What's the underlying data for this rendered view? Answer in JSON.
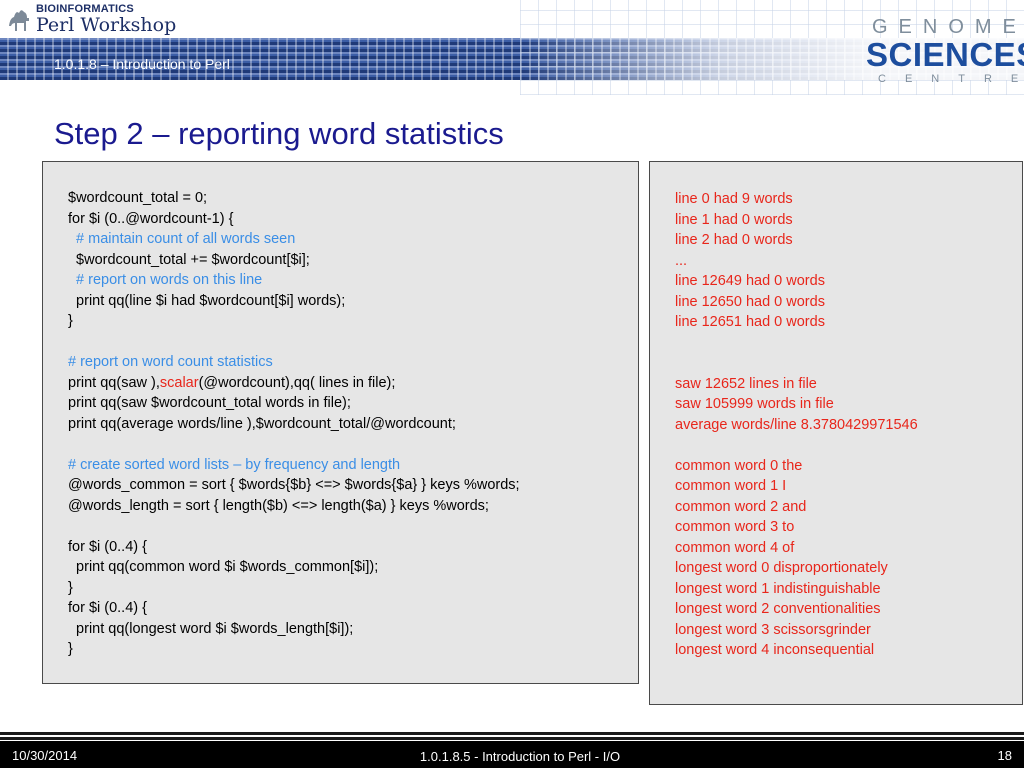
{
  "header": {
    "logo_top": "BIOINFORMATICS",
    "logo_main": "Perl Workshop",
    "subtitle": "1.0.1.8 – Introduction to Perl",
    "gsc_line1": "GENOME",
    "gsc_line2": "SCIENCES",
    "gsc_line3": "CENTRE"
  },
  "slide": {
    "title": "Step 2 – reporting word statistics"
  },
  "code": {
    "lines": [
      {
        "t": "$wordcount_total = 0;",
        "k": "code"
      },
      {
        "t": "for $i (0..@wordcount-1) {",
        "k": "code"
      },
      {
        "t": "  # maintain count of all words seen",
        "k": "comment"
      },
      {
        "t": "  $wordcount_total += $wordcount[$i];",
        "k": "code"
      },
      {
        "t": "  # report on words on this line",
        "k": "comment"
      },
      {
        "t": "  print qq(line $i had $wordcount[$i] words);",
        "k": "code"
      },
      {
        "t": "}",
        "k": "code"
      },
      {
        "t": "",
        "k": "code"
      },
      {
        "t": "# report on word count statistics",
        "k": "comment"
      },
      {
        "t": "print qq(saw ),",
        "kw": "scalar",
        "post": "(@wordcount),qq( lines in file);",
        "k": "code"
      },
      {
        "t": "print qq(saw $wordcount_total words in file);",
        "k": "code"
      },
      {
        "t": "print qq(average words/line ),$wordcount_total/@wordcount;",
        "k": "code"
      },
      {
        "t": "",
        "k": "code"
      },
      {
        "t": "# create sorted word lists – by frequency and length",
        "k": "comment"
      },
      {
        "t": "@words_common = sort { $words{$b} <=> $words{$a} } keys %words;",
        "k": "code"
      },
      {
        "t": "@words_length = sort { length($b) <=> length($a) } keys %words;",
        "k": "code"
      },
      {
        "t": "",
        "k": "code"
      },
      {
        "t": "for $i (0..4) {",
        "k": "code"
      },
      {
        "t": "  print qq(common word $i $words_common[$i]);",
        "k": "code"
      },
      {
        "t": "}",
        "k": "code"
      },
      {
        "t": "for $i (0..4) {",
        "k": "code"
      },
      {
        "t": "  print qq(longest word $i $words_length[$i]);",
        "k": "code"
      },
      {
        "t": "}",
        "k": "code"
      }
    ]
  },
  "output": {
    "lines": [
      "line 0 had 9 words",
      "line 1 had 0 words",
      "line 2 had 0 words",
      "...",
      "line 12649 had 0 words",
      "line 12650 had 0 words",
      "line 12651 had 0 words",
      "",
      "",
      "saw 12652 lines in file",
      "saw 105999 words in file",
      "average words/line 8.3780429971546",
      "",
      "common word 0 the",
      "common word 1 I",
      "common word 2 and",
      "common word 3 to",
      "common word 4 of",
      "longest word 0 disproportionately",
      "longest word 1 indistinguishable",
      "longest word 2 conventionalities",
      "longest word 3 scissorsgrinder",
      "longest word 4 inconsequential"
    ]
  },
  "footer": {
    "date": "10/30/2014",
    "center": "1.0.1.8.5 - Introduction to Perl - I/O",
    "page": "18"
  },
  "colors": {
    "title": "#1a1a8f",
    "comment": "#3a8ee6",
    "output": "#e8261b",
    "keyword": "#e8261b",
    "panel": "#e6e6e6"
  }
}
